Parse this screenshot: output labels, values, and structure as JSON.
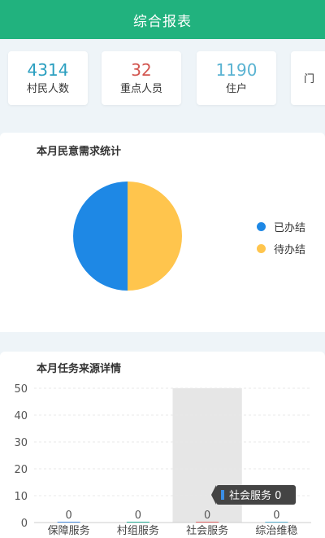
{
  "header": {
    "title": "综合报表"
  },
  "stats": [
    {
      "value": "4314",
      "label": "村民人数",
      "color": "#2b9fc0"
    },
    {
      "value": "32",
      "label": "重点人员",
      "color": "#d2554f"
    },
    {
      "value": "1190",
      "label": "住户",
      "color": "#5ab3d2"
    },
    {
      "value": "",
      "label": "门",
      "color": "#2b9fc0"
    }
  ],
  "pie_panel": {
    "title": "本月民意需求统计",
    "legend": [
      {
        "label": "已办结",
        "color": "#1e88e5"
      },
      {
        "label": "待办结",
        "color": "#ffc54d"
      }
    ]
  },
  "bar_panel": {
    "title": "本月任务来源详情",
    "tooltip": "社会服务 0"
  },
  "chart_data": [
    {
      "type": "pie",
      "title": "本月民意需求统计",
      "categories": [
        "已办结",
        "待办结"
      ],
      "values": [
        1,
        1
      ],
      "colors": [
        "#1e88e5",
        "#ffc54d"
      ]
    },
    {
      "type": "bar",
      "title": "本月任务来源详情",
      "categories": [
        "保障服务",
        "村组服务",
        "社会服务",
        "综治维稳"
      ],
      "values": [
        0,
        0,
        0,
        0
      ],
      "data_labels": [
        "0",
        "0",
        "0",
        "0"
      ],
      "bar_colors": [
        "#4a90e2",
        "#2bb39b",
        "#e06666",
        "#5ab3d2"
      ],
      "ylim": [
        0,
        50
      ],
      "yticks": [
        "0",
        "10",
        "20",
        "30",
        "40",
        "50"
      ],
      "highlighted_category": "社会服务",
      "grid": true
    }
  ]
}
